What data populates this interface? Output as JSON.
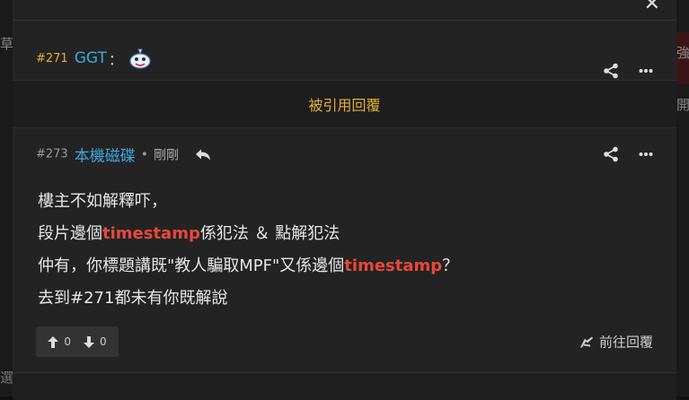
{
  "background": {
    "left_fragment": "草",
    "left_fragment_bottom": "選",
    "right_fragment": "強補",
    "right_fragment_2": "開上"
  },
  "modal": {
    "close_label": "✕"
  },
  "post_271": {
    "number": "#271",
    "username": "GGT",
    "colon": "："
  },
  "quoted_label": "被引用回覆",
  "post_273": {
    "number": "#273",
    "username": "本機磁碟",
    "separator": "•",
    "time": "剛剛",
    "body": {
      "line1": "樓主不如解釋吓，",
      "line2_a": "段片邊個",
      "line2_hl": "timestamp",
      "line2_b": "係犯法 ＆ 點解犯法",
      "line3_a": "仲有，你標題講既\"教人騙取MPF\"又係邊個",
      "line3_hl": "timestamp",
      "line3_b": "？",
      "line4": "去到#271都未有你既解說"
    },
    "upvotes": "0",
    "downvotes": "0",
    "goto_label": "前往回覆"
  },
  "colors": {
    "accent_gold": "#e0b03a",
    "username_blue": "#3fa9e0",
    "highlight_red": "#e8483b",
    "panel": "#232323"
  },
  "icons": [
    "close-icon",
    "share-icon",
    "more-icon",
    "reply-icon",
    "upvote-icon",
    "downvote-icon",
    "goto-reply-icon",
    "avatar-icon"
  ]
}
